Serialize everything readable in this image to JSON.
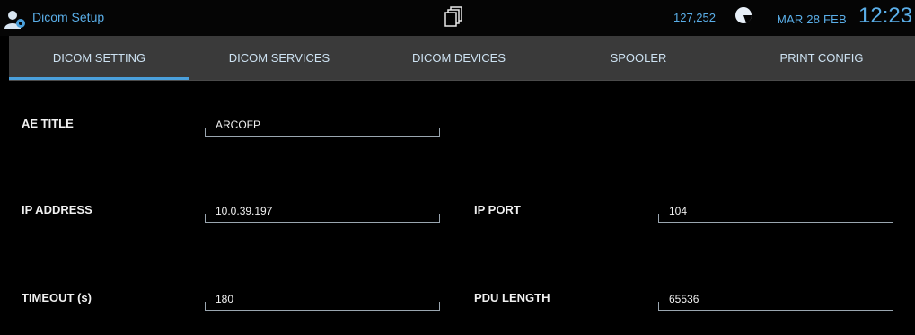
{
  "window": {
    "title": "Dicom Setup",
    "counter": "127,252",
    "date": "MAR 28 FEB",
    "time": "12:23"
  },
  "tabs": [
    {
      "label": "DICOM SETTING",
      "active": true
    },
    {
      "label": "DICOM SERVICES",
      "active": false
    },
    {
      "label": "DICOM DEVICES",
      "active": false
    },
    {
      "label": "SPOOLER",
      "active": false
    },
    {
      "label": "PRINT CONFIG",
      "active": false
    }
  ],
  "form": {
    "ae_title": {
      "label": "AE TITLE",
      "value": "ARCOFP"
    },
    "ip_address": {
      "label": "IP ADDRESS",
      "value": "10.0.39.197"
    },
    "ip_port": {
      "label": "IP PORT",
      "value": "104"
    },
    "timeout": {
      "label": "TIMEOUT (s)",
      "value": "180"
    },
    "pdu_length": {
      "label": "PDU LENGTH",
      "value": "65536"
    }
  },
  "colors": {
    "accent": "#4aa0dc",
    "tabbar": "#3a3a3a",
    "background": "#000000"
  },
  "icons": [
    "user-settings-icon",
    "documents-icon",
    "disk-usage-pie-icon"
  ]
}
